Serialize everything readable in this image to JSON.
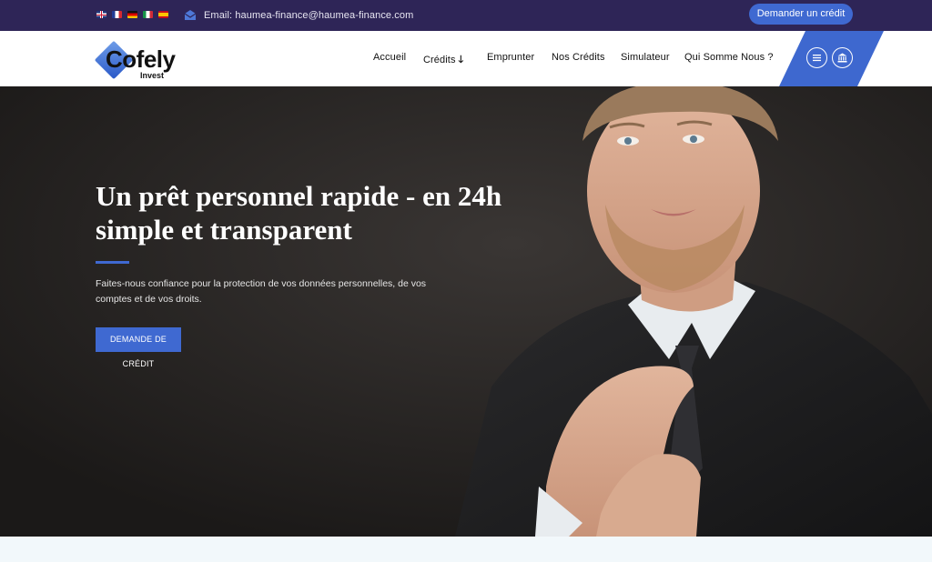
{
  "topbar": {
    "languages": [
      {
        "code": "uk",
        "name": "English"
      },
      {
        "code": "fr",
        "name": "Français"
      },
      {
        "code": "de",
        "name": "Deutsch"
      },
      {
        "code": "it",
        "name": "Italiano"
      },
      {
        "code": "es",
        "name": "Español"
      }
    ],
    "email_text": "Email: haumea-finance@haumea-finance.com",
    "cta_label": "Demander un crédit"
  },
  "header": {
    "logo": {
      "main": "Cofely",
      "sub": "Invest"
    },
    "nav": [
      {
        "label": "Accueil"
      },
      {
        "label": "Crédits",
        "has_dropdown": true,
        "icon": "arrow-down-icon"
      },
      {
        "label": "Emprunter"
      },
      {
        "label": "Nos Crédits"
      },
      {
        "label": "Simulateur"
      },
      {
        "label": "Qui Somme Nous ?"
      }
    ],
    "panel_buttons": [
      {
        "icon": "menu-icon"
      },
      {
        "icon": "bank-icon"
      }
    ]
  },
  "hero": {
    "title": "Un prêt personnel rapide - en 24h simple et transparent",
    "subtitle": "Faites-nous confiance pour la protection de vos données personnelles, de vos comptes et de vos droits.",
    "cta_label": "DEMANDE DE CRÉDIT"
  },
  "colors": {
    "topbar_bg": "#2e2557",
    "accent": "#3f69d1",
    "hero_bg": "#1e1c1b",
    "header_bg": "#ffffff"
  }
}
